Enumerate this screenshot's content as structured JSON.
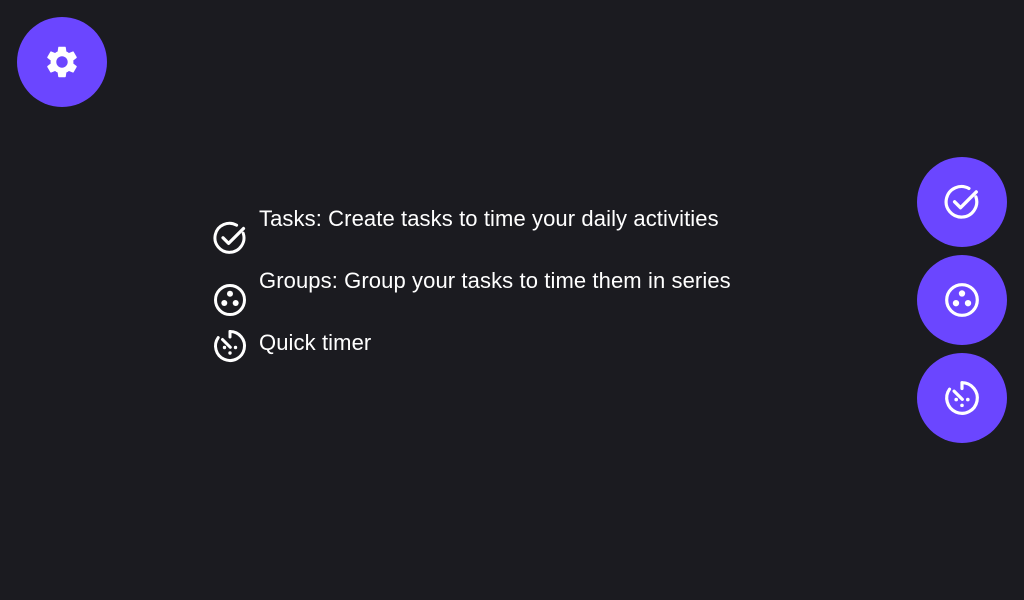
{
  "app": {
    "accent_color": "#6b46ff",
    "background_color": "#1b1b20",
    "text_color": "#ffffff"
  },
  "fabs": {
    "settings": {
      "icon": "gear-icon"
    },
    "tasks": {
      "icon": "check-circle-icon"
    },
    "groups": {
      "icon": "group-dots-icon"
    },
    "quick_timer": {
      "icon": "timer-icon"
    }
  },
  "legend": {
    "items": [
      {
        "icon": "check-circle-icon",
        "label": "Tasks: Create tasks to time your daily activities"
      },
      {
        "icon": "group-dots-icon",
        "label": "Groups: Group your tasks to time them in series"
      },
      {
        "icon": "timer-icon",
        "label": "Quick timer"
      }
    ]
  }
}
